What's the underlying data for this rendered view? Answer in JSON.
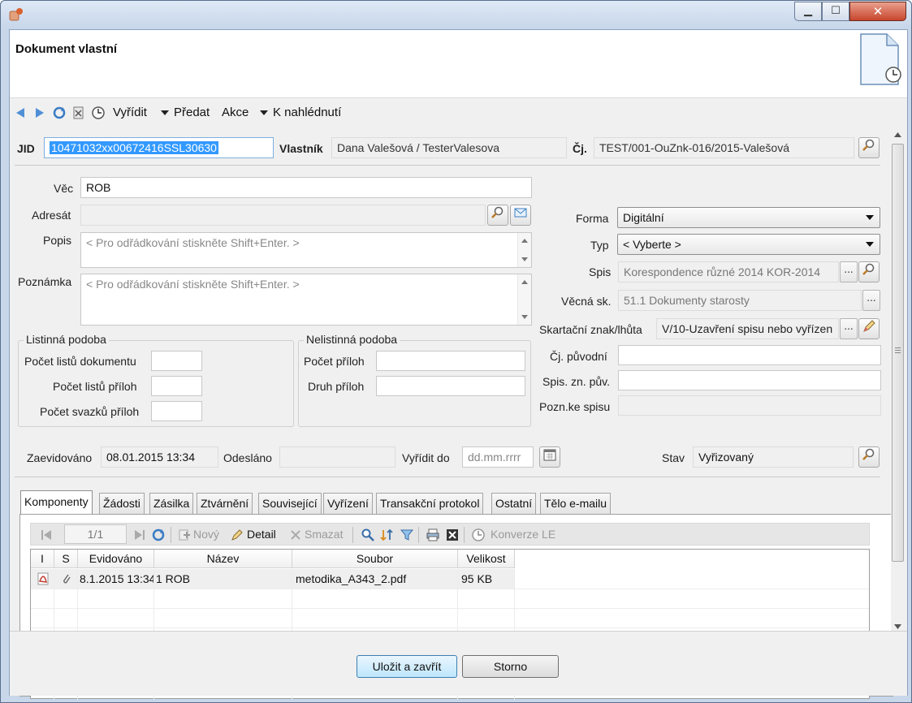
{
  "window": {
    "title": "Dokument vlastní",
    "min_label": "▁",
    "max_label": "☐",
    "close_label": "✕"
  },
  "toolbar": {
    "vyridit": "Vyřídit",
    "predat": "Předat",
    "akce": "Akce",
    "k_nahlednuti": "K nahlédnutí"
  },
  "header_fields": {
    "jid_label": "JID",
    "jid_value": "10471032xx00672416SSL30630",
    "vlastnik_label": "Vlastník",
    "vlastnik_value": "Dana Valešová / TesterValesova",
    "cj_label": "Čj.",
    "cj_value": "TEST/001-OuZnk-016/2015-Valešová"
  },
  "left_form": {
    "vec_label": "Věc",
    "vec_value": "ROB",
    "adresat_label": "Adresát",
    "adresat_value": "",
    "popis_label": "Popis",
    "popis_placeholder": "< Pro odřádkování stiskněte Shift+Enter. >",
    "poznamka_label": "Poznámka",
    "poznamka_placeholder": "< Pro odřádkování stiskněte Shift+Enter. >"
  },
  "listinna": {
    "title": "Listinná podoba",
    "pocet_listu_dokumentu": "Počet listů dokumentu",
    "pocet_listu_priloh": "Počet listů příloh",
    "pocet_svazku_priloh": "Počet svazků příloh"
  },
  "nelistinna": {
    "title": "Nelistinná podoba",
    "pocet_priloh": "Počet příloh",
    "druh_priloh": "Druh příloh"
  },
  "right_form": {
    "forma_label": "Forma",
    "forma_value": "Digitální",
    "typ_label": "Typ",
    "typ_value": "< Vyberte >",
    "spis_label": "Spis",
    "spis_value": "Korespondence různé 2014 KOR-2014",
    "vecna_label": "Věcná sk.",
    "vecna_value": "51.1 Dokumenty starosty",
    "skartacni_label": "Skartační znak/lhůta",
    "skartacni_value": "V/10-Uzavření spisu nebo vyřízen",
    "cj_puvodni_label": "Čj. původní",
    "spis_zn_label": "Spis. zn. pův.",
    "pozn_spisu_label": "Pozn.ke spisu",
    "dots": "..."
  },
  "status_row": {
    "zaevidovano_label": "Zaevidováno",
    "zaevidovano_value": "08.01.2015 13:34",
    "odeslano_label": "Odesláno",
    "vyridit_do_label": "Vyřídit do",
    "vyridit_do_placeholder": "dd.mm.rrrr",
    "stav_label": "Stav",
    "stav_value": "Vyřizovaný"
  },
  "tabs": [
    "Komponenty",
    "Žádosti",
    "Zásilka",
    "Ztvárnění",
    "Související",
    "Vyřízení",
    "Transakční protokol",
    "Ostatní",
    "Tělo e-mailu"
  ],
  "grid_toolbar": {
    "page": "1/1",
    "novy": "Nový",
    "detail": "Detail",
    "smazat": "Smazat",
    "konverze": "Konverze LE"
  },
  "grid": {
    "columns": [
      "I",
      "S",
      "Evidováno",
      "Název",
      "Soubor",
      "Velikost"
    ],
    "rows": [
      {
        "evidovano": "8.1.2015 13:34",
        "nazev": "1 ROB",
        "soubor": "metodika_A343_2.pdf",
        "velikost": "95 KB"
      }
    ]
  },
  "buttons": {
    "save": "Uložit a zavřít",
    "cancel": "Storno"
  }
}
